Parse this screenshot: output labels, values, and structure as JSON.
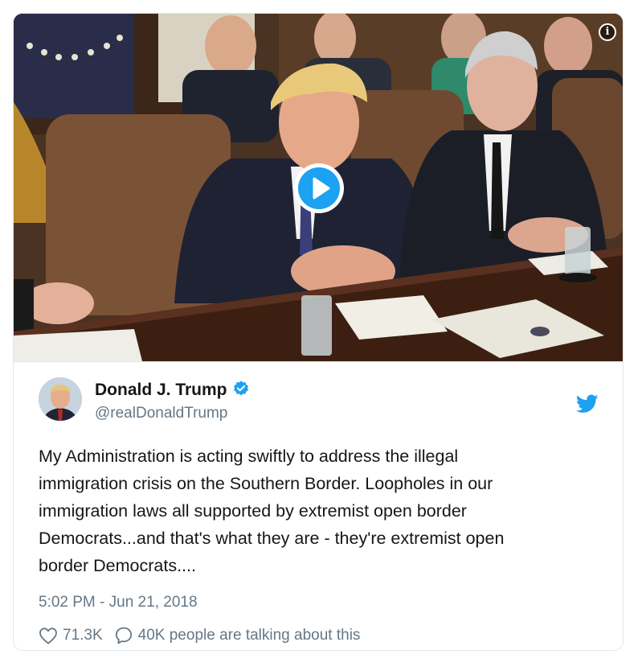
{
  "media": {
    "info_icon": "info-icon",
    "play_icon": "play-icon",
    "play_color": "#1da1f2"
  },
  "author": {
    "name": "Donald J. Trump",
    "handle": "@realDonaldTrump",
    "verified_icon": "verified-badge-icon",
    "verified_color": "#1da1f2"
  },
  "tweet": {
    "text_lines": [
      "My Administration is acting swiftly to address the illegal",
      "immigration crisis on the Southern Border. Loopholes in our",
      "immigration laws all supported by extremist open border",
      "Democrats...and that's what they are - they're extremist open",
      "border Democrats...."
    ],
    "timestamp": "5:02 PM - Jun 21, 2018"
  },
  "actions": {
    "likes": "71.3K",
    "talking": "40K people are talking about this",
    "like_icon": "heart-icon",
    "reply_icon": "speech-bubble-icon"
  },
  "brand": {
    "icon": "twitter-bird-icon",
    "color": "#1da1f2"
  }
}
